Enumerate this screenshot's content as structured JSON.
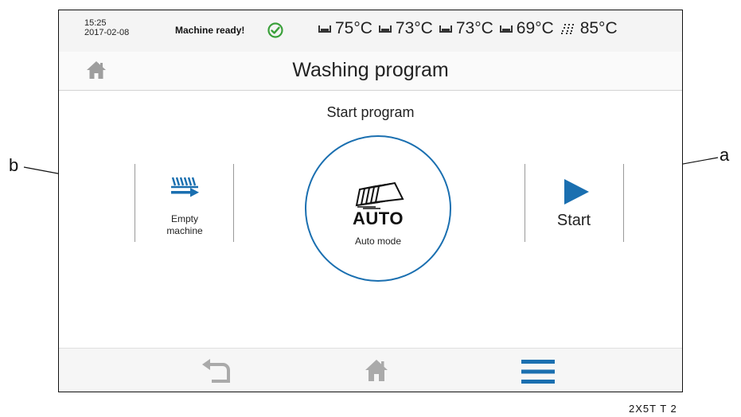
{
  "status": {
    "time": "15:25",
    "date": "2017-02-08",
    "message": "Machine ready!",
    "ok_icon": "check-circle-icon",
    "ok_color": "#3aa03a",
    "temperatures": [
      {
        "icon": "tank-icon",
        "value": "75°C"
      },
      {
        "icon": "tank-icon",
        "value": "73°C"
      },
      {
        "icon": "tank-icon",
        "value": "73°C"
      },
      {
        "icon": "tank-icon",
        "value": "69°C"
      },
      {
        "icon": "spray-icon",
        "value": "85°C"
      }
    ]
  },
  "header": {
    "title": "Washing program",
    "home_icon": "home-icon"
  },
  "main": {
    "subtitle": "Start program",
    "empty_machine": {
      "line1": "Empty",
      "line2": "machine",
      "icon": "empty-machine-icon"
    },
    "auto": {
      "word": "AUTO",
      "label": "Auto mode",
      "icon": "auto-racks-icon"
    },
    "start": {
      "label": "Start",
      "icon": "play-icon"
    }
  },
  "nav": {
    "back_icon": "back-arrow-icon",
    "home_icon": "home-icon",
    "menu_icon": "menu-icon"
  },
  "annotations": {
    "a": "a",
    "b": "b",
    "doc_ref": "2X5T T 2"
  },
  "colors": {
    "accent": "#1a6fb0",
    "border": "#111111",
    "icon_gray": "#9e9e9e"
  }
}
